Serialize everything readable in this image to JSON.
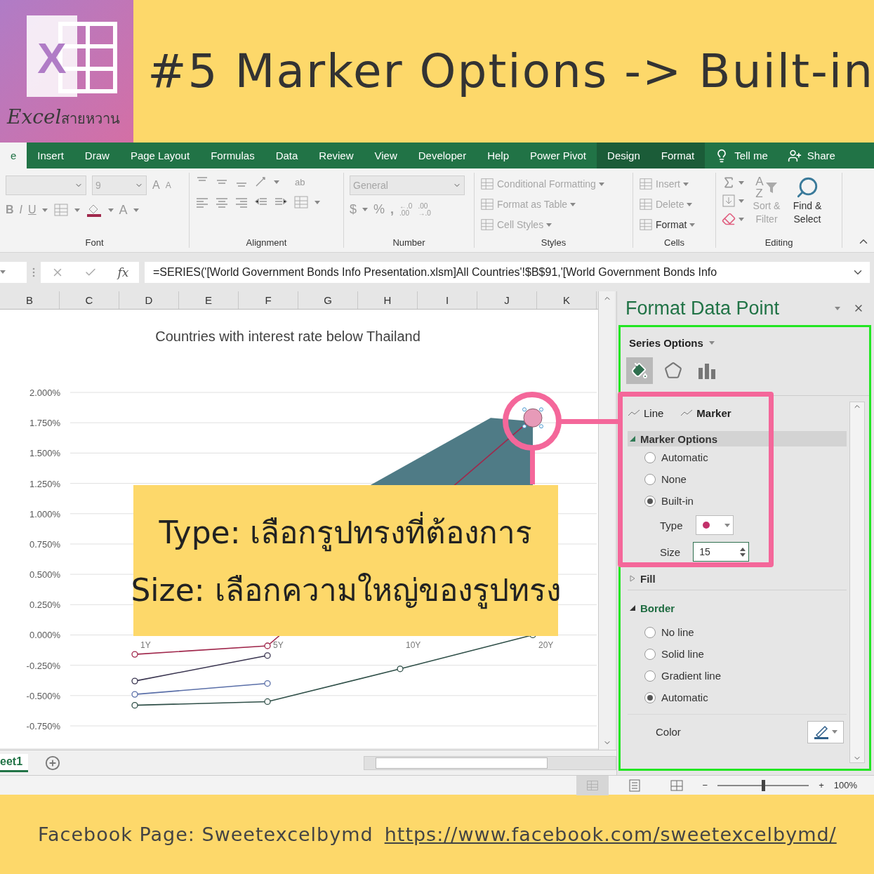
{
  "logo": {
    "letter": "X",
    "word": "Excel",
    "thai": "สายหวาน"
  },
  "title": "#5 Marker Options -> Built-in",
  "ribbon_tabs": [
    {
      "label": "e",
      "selected": true,
      "contextual": false
    },
    {
      "label": "Insert",
      "selected": false,
      "contextual": false
    },
    {
      "label": "Draw",
      "selected": false,
      "contextual": false
    },
    {
      "label": "Page Layout",
      "selected": false,
      "contextual": false
    },
    {
      "label": "Formulas",
      "selected": false,
      "contextual": false
    },
    {
      "label": "Data",
      "selected": false,
      "contextual": false
    },
    {
      "label": "Review",
      "selected": false,
      "contextual": false
    },
    {
      "label": "View",
      "selected": false,
      "contextual": false
    },
    {
      "label": "Developer",
      "selected": false,
      "contextual": false
    },
    {
      "label": "Help",
      "selected": false,
      "contextual": false
    },
    {
      "label": "Power Pivot",
      "selected": false,
      "contextual": false
    },
    {
      "label": "Design",
      "selected": false,
      "contextual": true
    },
    {
      "label": "Format",
      "selected": false,
      "contextual": true
    }
  ],
  "tell_me": "Tell me",
  "share": "Share",
  "ribbon": {
    "font": {
      "label": "Font",
      "size": "9",
      "grow_buttons": [
        "A",
        "A"
      ],
      "style_buttons": [
        "B",
        "I",
        "U"
      ],
      "color_button": "A"
    },
    "alignment": {
      "label": "Alignment",
      "wrap": "ab"
    },
    "number": {
      "label": "Number",
      "format": "General",
      "buttons": [
        "$",
        "%",
        ","
      ],
      "decimal_buttons": [
        {
          "top": "←.0",
          "bottom": ".00"
        },
        {
          "top": ".00",
          "bottom": "→.0"
        }
      ]
    },
    "styles": {
      "label": "Styles",
      "items": [
        {
          "label": "Conditional Formatting",
          "disabled": true
        },
        {
          "label": "Format as Table",
          "disabled": true
        },
        {
          "label": "Cell Styles",
          "disabled": true
        }
      ]
    },
    "cells": {
      "label": "Cells",
      "items": [
        {
          "label": "Insert",
          "disabled": true
        },
        {
          "label": "Delete",
          "disabled": true
        },
        {
          "label": "Format",
          "disabled": false
        }
      ]
    },
    "editing": {
      "label": "Editing",
      "sort_letters": [
        "A",
        "Z"
      ],
      "sort": {
        "label": "Sort & Filter",
        "disabled": true
      },
      "find": {
        "label": "Find & Select",
        "disabled": false
      }
    }
  },
  "formula_bar": {
    "fx": "fx",
    "formula": "=SERIES('[World Government Bonds Info Presentation.xlsm]All Countries'!$B$91,'[World Government Bonds Info"
  },
  "columns": [
    "B",
    "C",
    "D",
    "E",
    "F",
    "G",
    "H",
    "I",
    "J",
    "K"
  ],
  "chart_data": {
    "type": "line",
    "title": "Countries with interest rate below Thailand",
    "categories": [
      "1Y",
      "5Y",
      "10Y",
      "20Y"
    ],
    "yticks": [
      {
        "value": 2,
        "label": "2.000%"
      },
      {
        "value": 1.75,
        "label": "1.750%"
      },
      {
        "value": 1.5,
        "label": "1.500%"
      },
      {
        "value": 1.25,
        "label": "1.250%"
      },
      {
        "value": 1,
        "label": "1.000%"
      },
      {
        "value": 0.75,
        "label": "0.750%"
      },
      {
        "value": 0.5,
        "label": "0.500%"
      },
      {
        "value": 0.25,
        "label": "0.250%"
      },
      {
        "value": 0,
        "label": "0.000%"
      },
      {
        "value": -0.25,
        "label": "-0.250%"
      },
      {
        "value": -0.5,
        "label": "-0.500%"
      },
      {
        "value": -0.75,
        "label": "-0.750%"
      }
    ],
    "ylim": [
      -0.75,
      2
    ],
    "grid": true,
    "series": [
      {
        "color": "#a0284c",
        "marker": "circle",
        "values": [
          -0.16,
          -0.09,
          null,
          1.79
        ]
      },
      {
        "color": "#3a3550",
        "marker": "circle",
        "values": [
          -0.38,
          -0.17,
          null,
          null
        ]
      },
      {
        "color": "#5a6fa8",
        "marker": "circle",
        "values": [
          -0.49,
          -0.4,
          null,
          null
        ]
      },
      {
        "color": "#2f4f48",
        "marker": "circle",
        "values": [
          -0.58,
          -0.55,
          -0.28,
          0.0
        ]
      }
    ]
  },
  "callout": [
    "Type: เลือกรูปทรงที่ต้องการ",
    "Size: เลือกความใหญ่ของรูปทรง"
  ],
  "pane": {
    "title": "Format Data Point",
    "series_options": "Series Options",
    "icon_tabs": [
      {
        "kind": "fill",
        "selected": true
      },
      {
        "kind": "effects",
        "selected": false
      },
      {
        "kind": "options",
        "selected": false
      }
    ],
    "subtabs": [
      {
        "label": "Line",
        "selected": false
      },
      {
        "label": "Marker",
        "selected": true
      }
    ],
    "marker_options": {
      "title": "Marker Options",
      "expanded": true,
      "options": [
        {
          "label": "Automatic",
          "selected": false
        },
        {
          "label": "None",
          "selected": false
        },
        {
          "label": "Built-in",
          "selected": true
        }
      ],
      "type_label": "Type",
      "size_label": "Size",
      "size": "15"
    },
    "fill": {
      "title": "Fill",
      "expanded": false
    },
    "border": {
      "title": "Border",
      "expanded": true,
      "options": [
        {
          "label": "No line",
          "selected": false
        },
        {
          "label": "Solid line",
          "selected": false
        },
        {
          "label": "Gradient line",
          "selected": false
        },
        {
          "label": "Automatic",
          "selected": true
        }
      ],
      "color_label": "Color"
    }
  },
  "sheet_tab": "eet1",
  "status": {
    "minus": "−",
    "plus": "+",
    "zoom": "100%",
    "zoom_slider": {
      "level": 0.5
    }
  },
  "footer": {
    "text": "Facebook Page: Sweetexcelbymd",
    "link": "https://www.facebook.com/sweetexcelbymd/"
  }
}
